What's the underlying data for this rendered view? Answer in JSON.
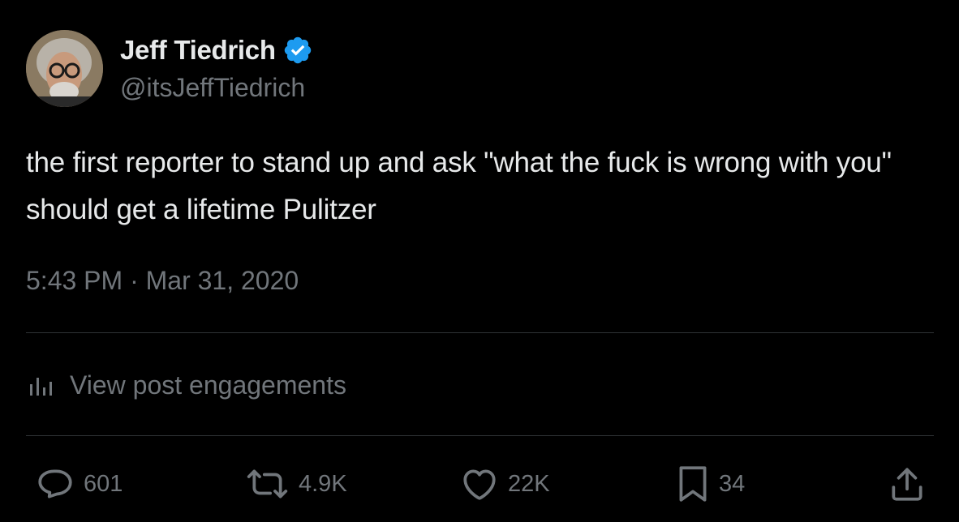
{
  "author": {
    "display_name": "Jeff Tiedrich",
    "handle": "@itsJeffTiedrich",
    "verified_icon": "verified-badge-icon",
    "verified_color": "#1d9bf0"
  },
  "post": {
    "text": "the first reporter to stand up and ask \"what the fuck is wrong with you\" should get a lifetime Pulitzer",
    "timestamp": "5:43 PM · Mar 31, 2020"
  },
  "engagements_link": {
    "label": "View post engagements",
    "icon": "analytics-icon"
  },
  "actions": {
    "reply": {
      "icon": "reply-icon",
      "count": "601"
    },
    "repost": {
      "icon": "repost-icon",
      "count": "4.9K"
    },
    "like": {
      "icon": "heart-icon",
      "count": "22K"
    },
    "bookmark": {
      "icon": "bookmark-icon",
      "count": "34"
    },
    "share": {
      "icon": "share-icon"
    }
  },
  "colors": {
    "background": "#000000",
    "primary_text": "#e7e9ea",
    "secondary_text": "#71767b",
    "divider": "#2f3336"
  }
}
